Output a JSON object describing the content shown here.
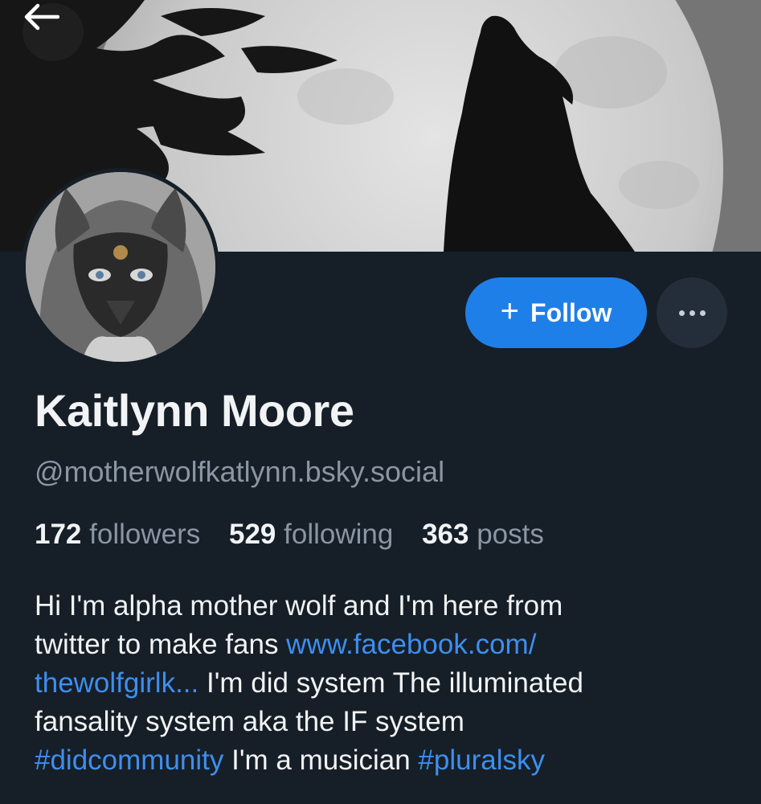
{
  "header": {
    "back_icon": "arrow-left-icon"
  },
  "profile": {
    "display_name": "Kaitlynn Moore",
    "handle": "@motherwolfkatlynn.bsky.social",
    "follow_label": "Follow",
    "follow_icon": "plus-icon",
    "more_icon": "ellipsis-icon",
    "stats": {
      "followers_count": "172",
      "followers_label": "followers",
      "following_count": "529",
      "following_label": "following",
      "posts_count": "363",
      "posts_label": "posts"
    },
    "bio": {
      "l1": "Hi I'm  alpha mother wolf and I'm here from",
      "l2_text": "twitter to make fans ",
      "l2_link": "www.facebook.com/",
      "l3_link": "thewolfgirlk...",
      "l3_text": " I'm did system  The illuminated",
      "l4": "fansality system aka the IF system",
      "l5_tag": "#didcommunity",
      "l5_text": " I'm a musician ",
      "l5_tag2": "#pluralsky"
    }
  },
  "colors": {
    "background": "#161e27",
    "accent": "#1f7fe8",
    "link": "#3d8fee",
    "muted": "#8a96a3",
    "text": "#f1f3f5"
  }
}
